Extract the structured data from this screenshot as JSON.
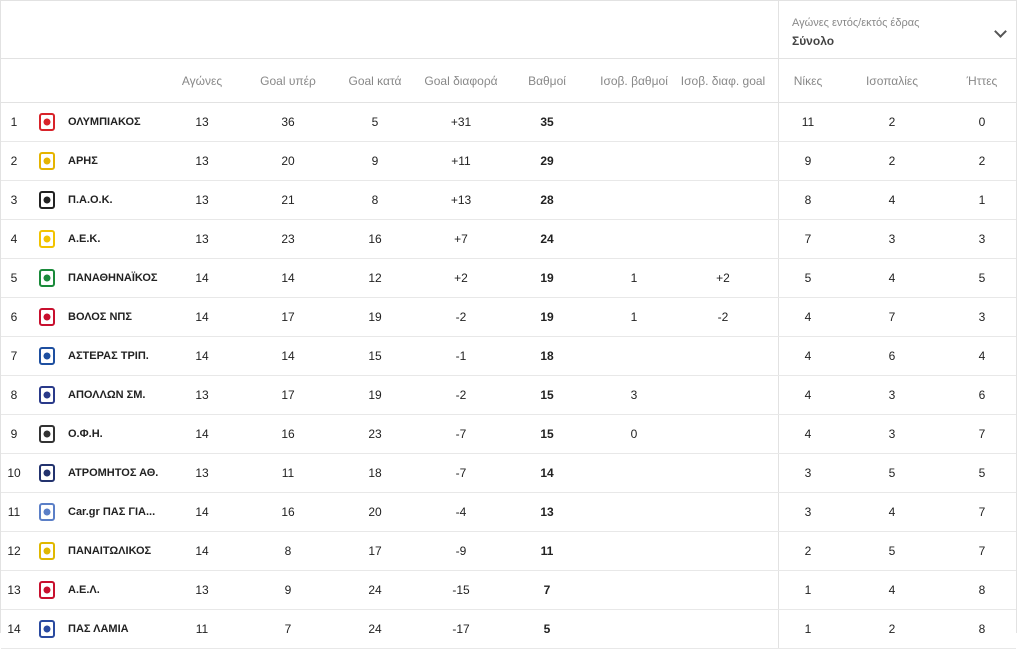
{
  "filter": {
    "label": "Αγώνες εντός/εκτός έδρας",
    "value": "Σύνολο"
  },
  "columns": [
    "Αγώνες",
    "Goal υπέρ",
    "Goal κατά",
    "Goal διαφορά",
    "Βαθμοί",
    "Ισοβ. βαθμοί",
    "Ισοβ. διαφ. goal",
    "Νίκες",
    "Ισοπαλίες",
    "Ήττες"
  ],
  "rows": [
    {
      "pos": "1",
      "team": "ΟΛΥΜΠΙΑΚΟΣ",
      "played": "13",
      "gf": "36",
      "ga": "5",
      "gd": "+31",
      "pts": "35",
      "tie_pts": "",
      "tie_gd": "",
      "w": "11",
      "d": "2",
      "l": "0",
      "color": "#d8232a"
    },
    {
      "pos": "2",
      "team": "ΑΡΗΣ",
      "played": "13",
      "gf": "20",
      "ga": "9",
      "gd": "+11",
      "pts": "29",
      "tie_pts": "",
      "tie_gd": "",
      "w": "9",
      "d": "2",
      "l": "2",
      "color": "#e5b400"
    },
    {
      "pos": "3",
      "team": "Π.Α.Ο.Κ.",
      "played": "13",
      "gf": "21",
      "ga": "8",
      "gd": "+13",
      "pts": "28",
      "tie_pts": "",
      "tie_gd": "",
      "w": "8",
      "d": "4",
      "l": "1",
      "color": "#222222"
    },
    {
      "pos": "4",
      "team": "Α.Ε.Κ.",
      "played": "13",
      "gf": "23",
      "ga": "16",
      "gd": "+7",
      "pts": "24",
      "tie_pts": "",
      "tie_gd": "",
      "w": "7",
      "d": "3",
      "l": "3",
      "color": "#f2c300"
    },
    {
      "pos": "5",
      "team": "ΠΑΝΑΘΗΝΑΪΚΟΣ",
      "played": "14",
      "gf": "14",
      "ga": "12",
      "gd": "+2",
      "pts": "19",
      "tie_pts": "1",
      "tie_gd": "+2",
      "w": "5",
      "d": "4",
      "l": "5",
      "color": "#1a8a3a"
    },
    {
      "pos": "6",
      "team": "ΒΟΛΟΣ ΝΠΣ",
      "played": "14",
      "gf": "17",
      "ga": "19",
      "gd": "-2",
      "pts": "19",
      "tie_pts": "1",
      "tie_gd": "-2",
      "w": "4",
      "d": "7",
      "l": "3",
      "color": "#c8102e"
    },
    {
      "pos": "7",
      "team": "ΑΣΤΕΡΑΣ ΤΡΙΠ.",
      "played": "14",
      "gf": "14",
      "ga": "15",
      "gd": "-1",
      "pts": "18",
      "tie_pts": "",
      "tie_gd": "",
      "w": "4",
      "d": "6",
      "l": "4",
      "color": "#1e4fa0"
    },
    {
      "pos": "8",
      "team": "ΑΠΟΛΛΩΝ ΣΜ.",
      "played": "13",
      "gf": "17",
      "ga": "19",
      "gd": "-2",
      "pts": "15",
      "tie_pts": "3",
      "tie_gd": "",
      "w": "4",
      "d": "3",
      "l": "6",
      "color": "#2a3a8a"
    },
    {
      "pos": "9",
      "team": "Ο.Φ.Η.",
      "played": "14",
      "gf": "16",
      "ga": "23",
      "gd": "-7",
      "pts": "15",
      "tie_pts": "0",
      "tie_gd": "",
      "w": "4",
      "d": "3",
      "l": "7",
      "color": "#333333"
    },
    {
      "pos": "10",
      "team": "ΑΤΡΟΜΗΤΟΣ ΑΘ.",
      "played": "13",
      "gf": "11",
      "ga": "18",
      "gd": "-7",
      "pts": "14",
      "tie_pts": "",
      "tie_gd": "",
      "w": "3",
      "d": "5",
      "l": "5",
      "color": "#23336e"
    },
    {
      "pos": "11",
      "team": "Car.gr ΠΑΣ ΓΙΑ...",
      "played": "14",
      "gf": "16",
      "ga": "20",
      "gd": "-4",
      "pts": "13",
      "tie_pts": "",
      "tie_gd": "",
      "w": "3",
      "d": "4",
      "l": "7",
      "color": "#5b7fc7"
    },
    {
      "pos": "12",
      "team": "ΠΑΝΑΙΤΩΛΙΚΟΣ",
      "played": "14",
      "gf": "8",
      "ga": "17",
      "gd": "-9",
      "pts": "11",
      "tie_pts": "",
      "tie_gd": "",
      "w": "2",
      "d": "5",
      "l": "7",
      "color": "#e0b800"
    },
    {
      "pos": "13",
      "team": "Α.Ε.Λ.",
      "played": "13",
      "gf": "9",
      "ga": "24",
      "gd": "-15",
      "pts": "7",
      "tie_pts": "",
      "tie_gd": "",
      "w": "1",
      "d": "4",
      "l": "8",
      "color": "#c8102e"
    },
    {
      "pos": "14",
      "team": "ΠΑΣ ΛΑΜΙΑ",
      "played": "11",
      "gf": "7",
      "ga": "24",
      "gd": "-17",
      "pts": "5",
      "tie_pts": "",
      "tie_gd": "",
      "w": "1",
      "d": "2",
      "l": "8",
      "color": "#2a4aa0"
    }
  ]
}
